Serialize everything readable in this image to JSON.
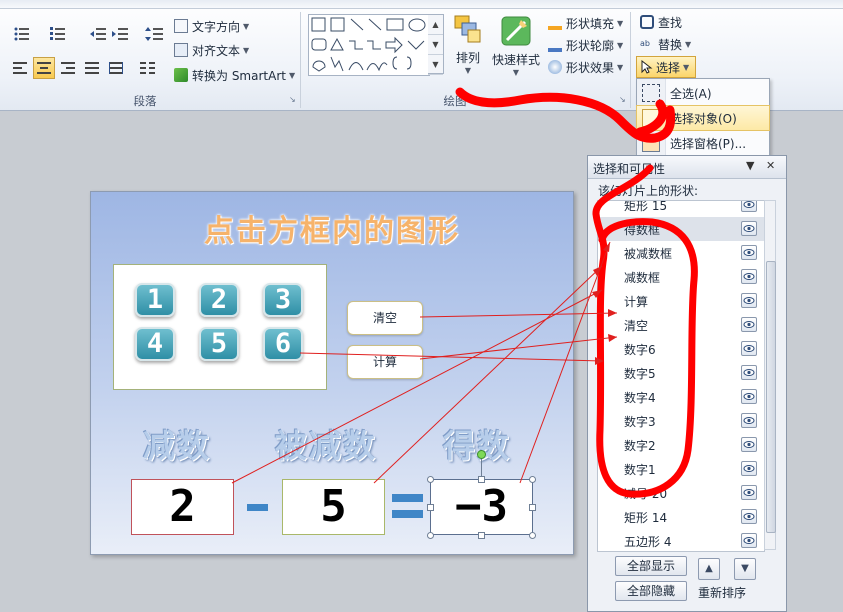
{
  "ribbon": {
    "paragraph": {
      "group_label": "段落",
      "text_direction": "文字方向",
      "align_text": "对齐文本",
      "convert_smartart": "转换为 SmartArt"
    },
    "drawing": {
      "group_label": "绘图",
      "arrange_label": "排列",
      "quick_styles_label": "快速样式",
      "shape_fill": "形状填充",
      "shape_outline": "形状轮廓",
      "shape_effects": "形状效果"
    },
    "editing": {
      "find": "查找",
      "replace": "替换",
      "select": "选择"
    }
  },
  "select_menu": {
    "items": [
      {
        "label": "全选(A)"
      },
      {
        "label": "选择对象(O)"
      },
      {
        "label": "选择窗格(P)..."
      }
    ]
  },
  "slide": {
    "title": "点击方框内的图形",
    "keys": [
      "1",
      "2",
      "3",
      "4",
      "5",
      "6"
    ],
    "clear_button": "清空",
    "calc_button": "计算",
    "label_subtrahend": "减数",
    "label_minuend": "被减数",
    "label_result": "得数",
    "value_subtrahend": "2",
    "value_minuend": "5",
    "value_result": "−3"
  },
  "selection_pane": {
    "title": "选择和可见性",
    "subtitle": "该幻灯片上的形状:",
    "items": [
      {
        "name": "矩形 15",
        "selected": false
      },
      {
        "name": "得数框",
        "selected": true
      },
      {
        "name": "被减数框",
        "selected": false
      },
      {
        "name": "减数框",
        "selected": false
      },
      {
        "name": "计算",
        "selected": false
      },
      {
        "name": "清空",
        "selected": false
      },
      {
        "name": "数字6",
        "selected": false
      },
      {
        "name": "数字5",
        "selected": false
      },
      {
        "name": "数字4",
        "selected": false
      },
      {
        "name": "数字3",
        "selected": false
      },
      {
        "name": "数字2",
        "selected": false
      },
      {
        "name": "数字1",
        "selected": false
      },
      {
        "name": "减号 20",
        "selected": false
      },
      {
        "name": "矩形 14",
        "selected": false
      },
      {
        "name": "五边形 4",
        "selected": false
      }
    ],
    "show_all": "全部显示",
    "hide_all": "全部隐藏",
    "reorder": "重新排序"
  },
  "colors": {
    "annotation": "#ff0000",
    "arrow": "#e0201f",
    "key_fill": "#3a9ab0",
    "equals": "#3f86c7"
  }
}
